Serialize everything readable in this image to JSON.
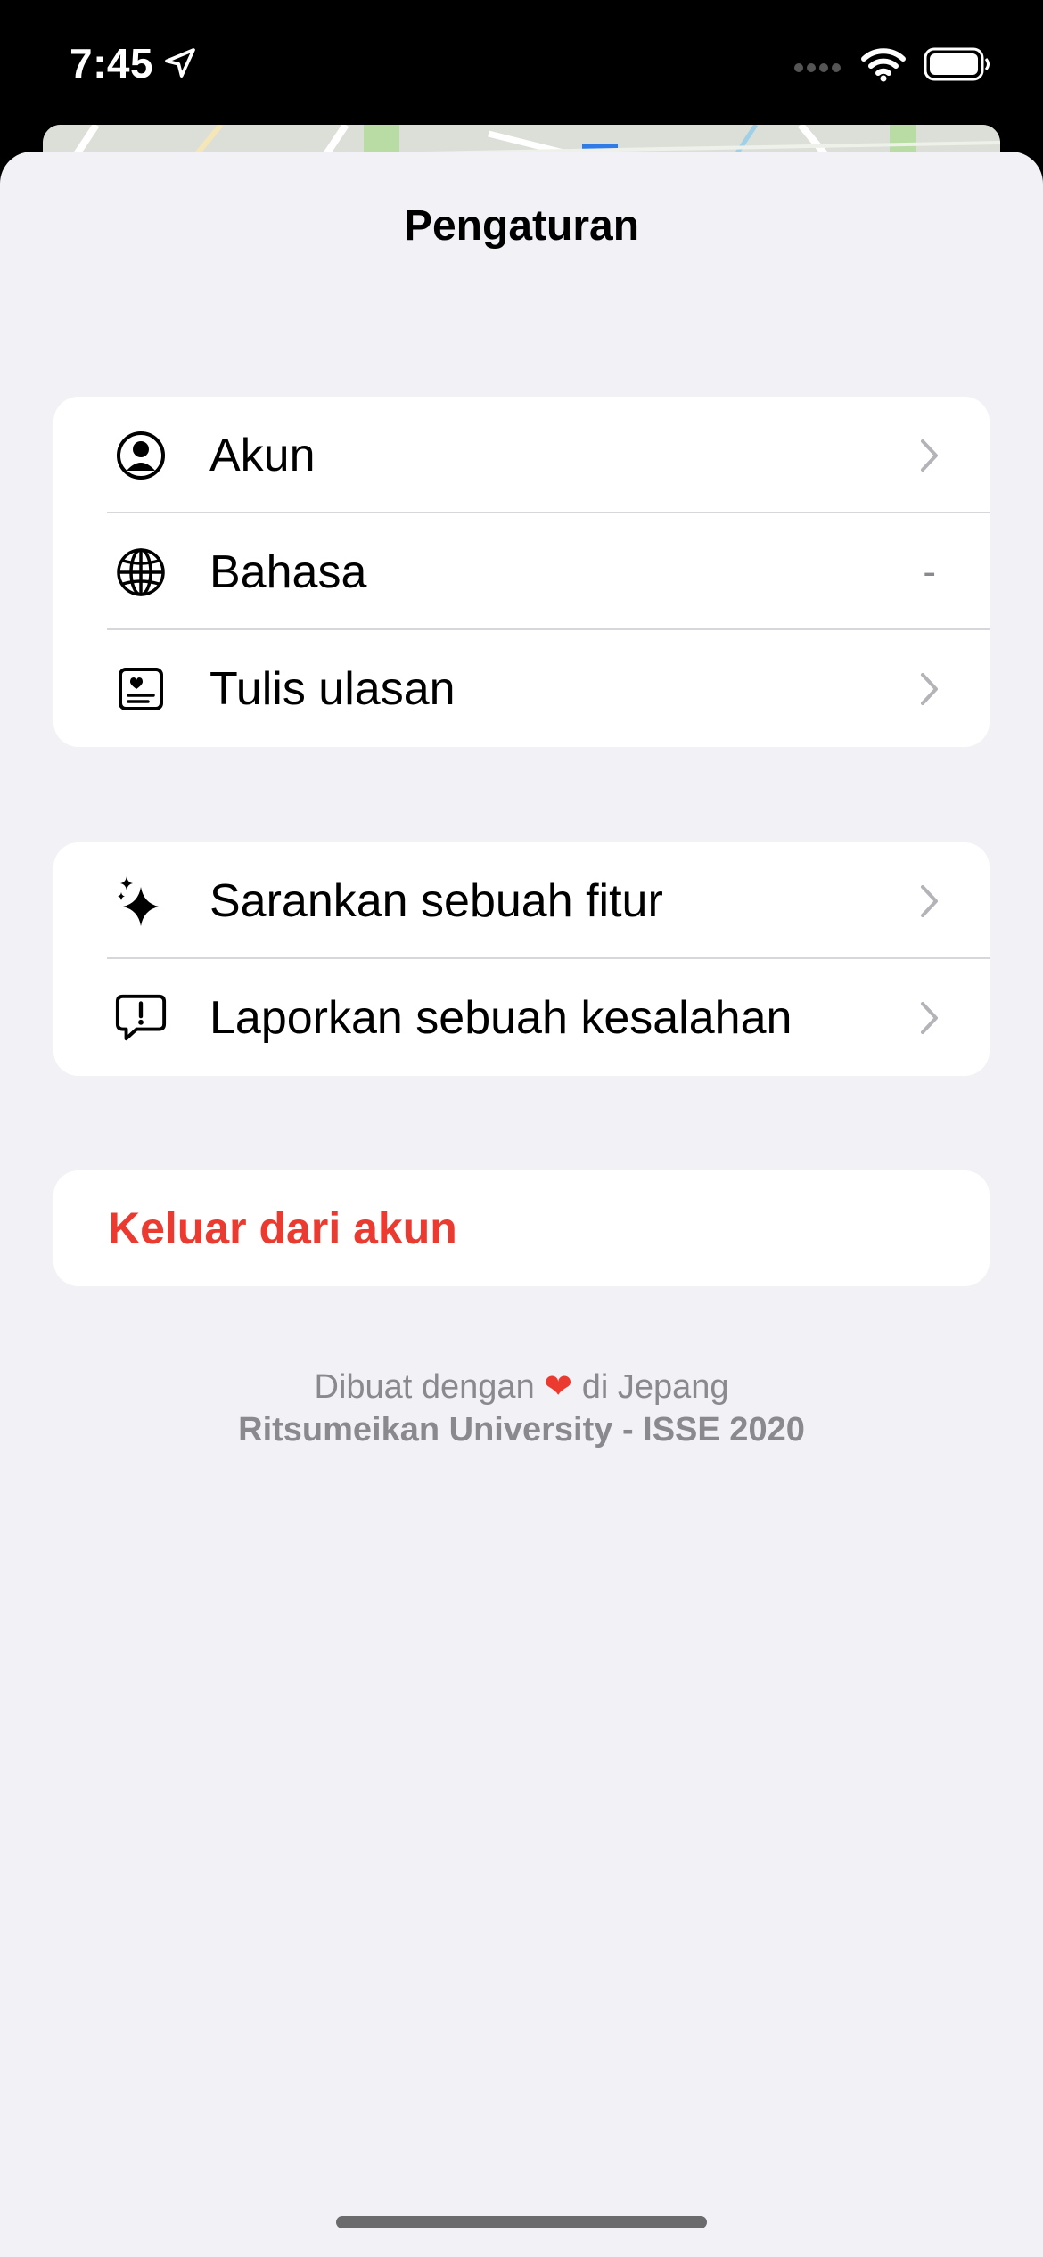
{
  "status_bar": {
    "time": "7:45"
  },
  "sheet": {
    "title": "Pengaturan"
  },
  "group1": [
    {
      "label": "Akun",
      "icon": "person-circle-icon",
      "trail": "chevron"
    },
    {
      "label": "Bahasa",
      "icon": "globe-icon",
      "trail": "-"
    },
    {
      "label": "Tulis ulasan",
      "icon": "review-card-icon",
      "trail": "chevron"
    }
  ],
  "group2": [
    {
      "label": "Sarankan sebuah fitur",
      "icon": "sparkles-icon",
      "trail": "chevron"
    },
    {
      "label": "Laporkan sebuah kesalahan",
      "icon": "exclamation-bubble-icon",
      "trail": "chevron"
    }
  ],
  "signout": {
    "label": "Keluar dari akun",
    "color": "#eb3b30"
  },
  "footer": {
    "line1_before": "Dibuat dengan",
    "heart": "❤",
    "line1_after": "di Jepang",
    "line2": "Ritsumeikan University - ISSE 2020"
  },
  "colors": {
    "background": "#f1f1f6",
    "card": "#ffffff",
    "destructive": "#eb3b30",
    "secondary_text": "#8a8a8e"
  }
}
